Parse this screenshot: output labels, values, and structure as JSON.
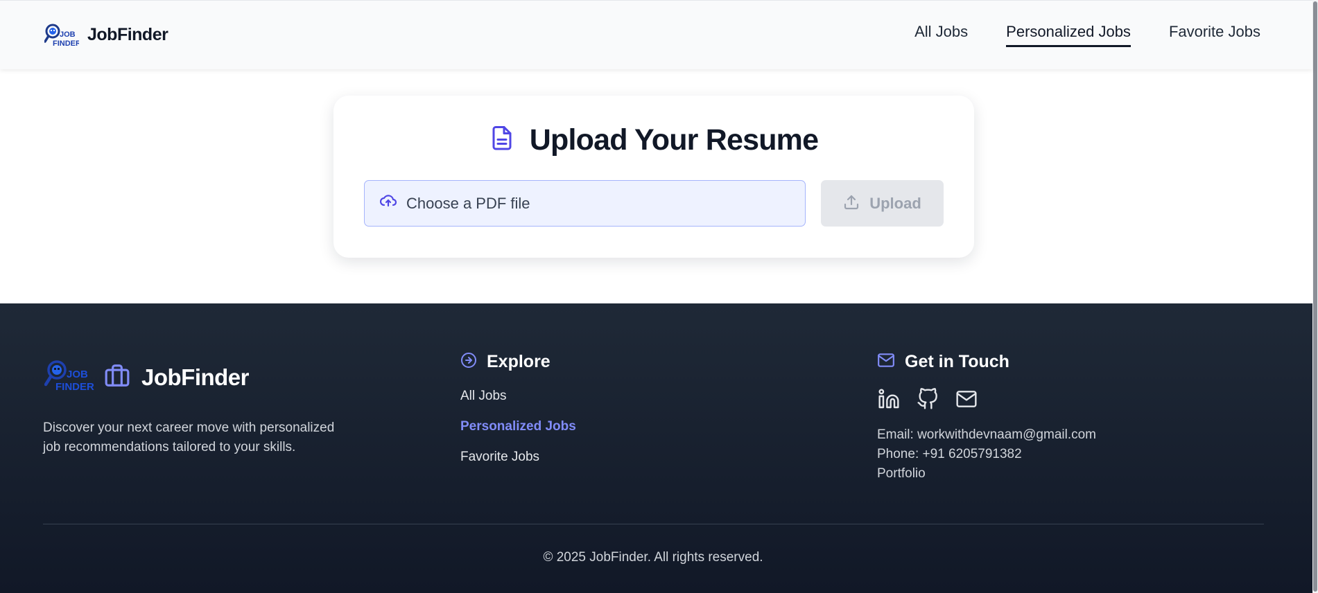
{
  "header": {
    "brand_name": "JobFinder",
    "logo_text_top": "JOB",
    "logo_text_bottom": "FINDER",
    "nav": [
      {
        "label": "All Jobs",
        "active": false
      },
      {
        "label": "Personalized Jobs",
        "active": true
      },
      {
        "label": "Favorite Jobs",
        "active": false
      }
    ]
  },
  "upload_card": {
    "title": "Upload Your Resume",
    "file_picker_label": "Choose a PDF file",
    "upload_button_label": "Upload",
    "upload_button_disabled": true
  },
  "footer": {
    "brand_name": "JobFinder",
    "logo_text_top": "JOB",
    "logo_text_bottom": "FINDER",
    "description": "Discover your next career move with personalized job recommendations tailored to your skills.",
    "explore": {
      "heading": "Explore",
      "links": [
        {
          "label": "All Jobs",
          "active": false
        },
        {
          "label": "Personalized Jobs",
          "active": true
        },
        {
          "label": "Favorite Jobs",
          "active": false
        }
      ]
    },
    "contact": {
      "heading": "Get in Touch",
      "social_icons": [
        "linkedin-icon",
        "github-icon",
        "mail-icon"
      ],
      "email": "Email: workwithdevnaam@gmail.com",
      "phone": "Phone: +91 6205791382",
      "portfolio": "Portfolio"
    },
    "copyright": "© 2025 JobFinder. All rights reserved."
  },
  "colors": {
    "accent": "#4f46e5",
    "accent_light": "#818cf8",
    "footer_bg": "#1f2937",
    "picker_bg": "#eef2ff",
    "text_dark": "#111827"
  }
}
